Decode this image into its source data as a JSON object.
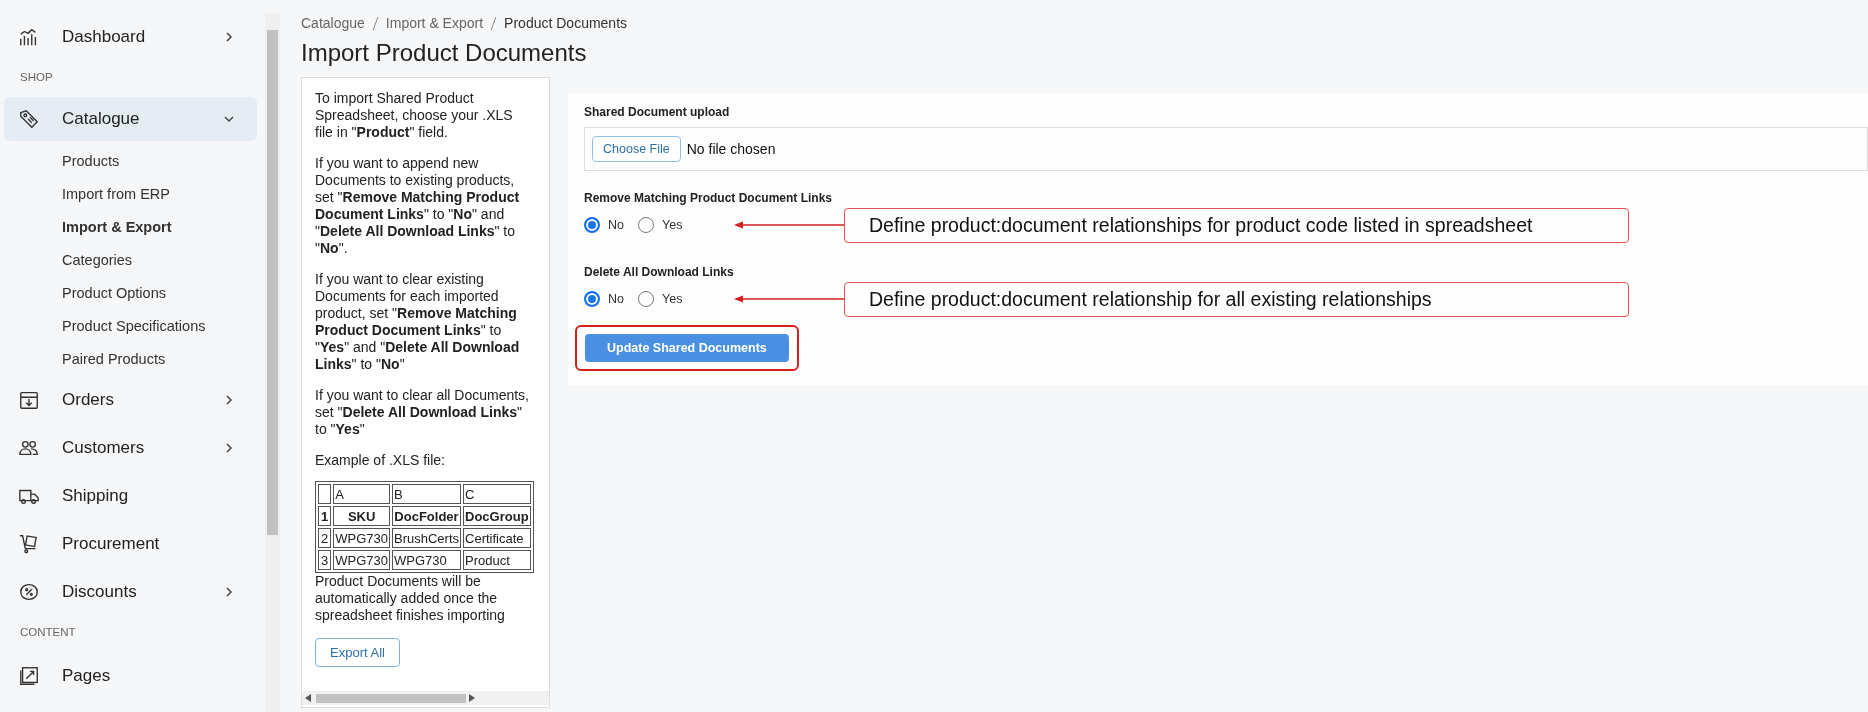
{
  "sidebar": {
    "items": [
      {
        "kind": "item",
        "label": "Dashboard",
        "selected": false,
        "expanded": false
      },
      {
        "kind": "section",
        "label": "SHOP"
      },
      {
        "kind": "item",
        "label": "Catalogue",
        "selected": true,
        "expanded": true,
        "children": [
          {
            "label": "Products",
            "selected": false
          },
          {
            "label": "Import from ERP",
            "selected": false
          },
          {
            "label": "Import & Export",
            "selected": true
          },
          {
            "label": "Categories",
            "selected": false
          },
          {
            "label": "Product Options",
            "selected": false
          },
          {
            "label": "Product Specifications",
            "selected": false
          },
          {
            "label": "Paired Products",
            "selected": false
          }
        ]
      },
      {
        "kind": "item",
        "label": "Orders",
        "selected": false,
        "expanded": false
      },
      {
        "kind": "item",
        "label": "Customers",
        "selected": false,
        "expanded": false
      },
      {
        "kind": "item",
        "label": "Shipping",
        "selected": false
      },
      {
        "kind": "item",
        "label": "Procurement",
        "selected": false
      },
      {
        "kind": "item",
        "label": "Discounts",
        "selected": false,
        "expanded": false
      },
      {
        "kind": "section",
        "label": "CONTENT"
      },
      {
        "kind": "item",
        "label": "Pages",
        "selected": false
      }
    ]
  },
  "breadcrumb": [
    "Catalogue",
    "Import & Export",
    "Product Documents"
  ],
  "title": "Import Product Documents",
  "instructions": {
    "paragraphs": [
      "To import Shared Product Spreadsheet, choose your .XLS file in \"**Product**\" field.",
      "If you want to append new Documents to existing products, set \"**Remove Matching Product Document Links**\" to \"**No**\" and \"**Delete All Download Links**\" to \"**No**\".",
      "If you want to clear existing Documents for each imported product, set \"**Remove Matching Product Document Links**\" to \"**Yes**\" and \"**Delete All Download Links**\" to \"**No**\"",
      "If you want to clear all Documents, set \"**Delete All Download Links**\" to \"**Yes**\"",
      "Example of .XLS file:"
    ],
    "example_table": {
      "columns": [
        "A",
        "B",
        "C"
      ],
      "header_row": {
        "index": "1",
        "cells": [
          "SKU",
          "DocFolder",
          "DocGroup"
        ]
      },
      "rows": [
        {
          "index": "2",
          "cells": [
            "WPG730",
            "BrushCerts",
            "Certificate"
          ]
        },
        {
          "index": "3",
          "cells": [
            "WPG730",
            "WPG730",
            "Product"
          ]
        }
      ]
    },
    "note": "Product Documents will be automatically added once the spreadsheet finishes importing",
    "export_button": "Export All"
  },
  "form": {
    "upload": {
      "label": "Shared Document upload",
      "button": "Choose File",
      "value": "No file chosen"
    },
    "groups": [
      {
        "label": "Remove Matching Product Document Links",
        "options": [
          {
            "label": "No",
            "selected": true
          },
          {
            "label": "Yes",
            "selected": false
          }
        ],
        "annotation": "Define product:document relationships for product code listed in spreadsheet"
      },
      {
        "label": "Delete All Download Links",
        "options": [
          {
            "label": "No",
            "selected": true
          },
          {
            "label": "Yes",
            "selected": false
          }
        ],
        "annotation": "Define product:document relationship for all existing relationships"
      }
    ],
    "submit": {
      "label": "Update Shared Documents",
      "highlighted": true
    }
  }
}
